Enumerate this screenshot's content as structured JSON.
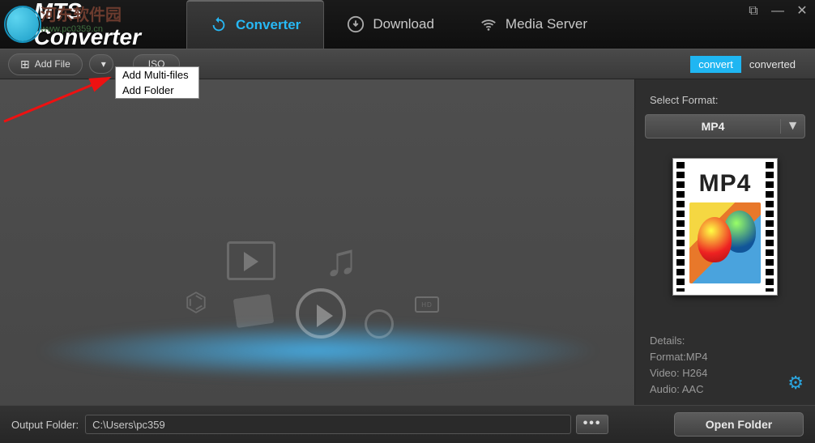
{
  "app": {
    "title": "MTS Converter"
  },
  "watermark": {
    "line1": "河东软件园",
    "line2": "www.pc0359.cn"
  },
  "nav": {
    "converter": "Converter",
    "download": "Download",
    "media_server": "Media Server"
  },
  "toolbar": {
    "add_file": "Add File",
    "iso_suffix": "ISO",
    "dropdown": {
      "multi": "Add Multi-files",
      "folder": "Add Folder"
    },
    "tab_convert": "convert",
    "tab_converted": "converted"
  },
  "side": {
    "title": "Select Format:",
    "format": "MP4",
    "thumb_label": "MP4",
    "details_header": "Details:",
    "format_line": "Format:MP4",
    "video_line": "Video: H264",
    "audio_line": "Audio: AAC"
  },
  "bottom": {
    "label": "Output Folder:",
    "path": "C:\\Users\\pc359",
    "browse": "•••",
    "open_folder": "Open Folder"
  },
  "ghost": {
    "hd": "HD"
  }
}
